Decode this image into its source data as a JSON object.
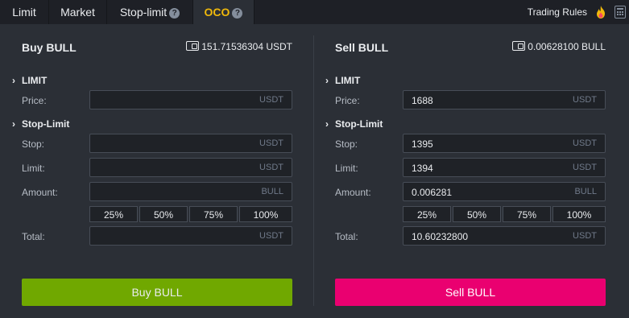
{
  "tabs": [
    {
      "label": "Limit"
    },
    {
      "label": "Market"
    },
    {
      "label": "Stop-limit",
      "help": "?"
    },
    {
      "label": "OCO",
      "help": "?"
    }
  ],
  "trading_rules": "Trading Rules",
  "colors": {
    "accent": "#f0b90b",
    "buy": "#70a800",
    "sell": "#ea0070"
  },
  "buy": {
    "title": "Buy BULL",
    "balance": "151.71536304 USDT",
    "section_limit": "LIMIT",
    "section_stoplimit": "Stop-Limit",
    "price_label": "Price:",
    "price_value": "",
    "price_unit": "USDT",
    "stop_label": "Stop:",
    "stop_value": "",
    "stop_unit": "USDT",
    "limit_label": "Limit:",
    "limit_value": "",
    "limit_unit": "USDT",
    "amount_label": "Amount:",
    "amount_value": "",
    "amount_unit": "BULL",
    "percents": [
      "25%",
      "50%",
      "75%",
      "100%"
    ],
    "total_label": "Total:",
    "total_value": "",
    "total_unit": "USDT",
    "button": "Buy BULL"
  },
  "sell": {
    "title": "Sell BULL",
    "balance": "0.00628100 BULL",
    "section_limit": "LIMIT",
    "section_stoplimit": "Stop-Limit",
    "price_label": "Price:",
    "price_value": "1688",
    "price_unit": "USDT",
    "stop_label": "Stop:",
    "stop_value": "1395",
    "stop_unit": "USDT",
    "limit_label": "Limit:",
    "limit_value": "1394",
    "limit_unit": "USDT",
    "amount_label": "Amount:",
    "amount_value": "0.006281",
    "amount_unit": "BULL",
    "percents": [
      "25%",
      "50%",
      "75%",
      "100%"
    ],
    "total_label": "Total:",
    "total_value": "10.60232800",
    "total_unit": "USDT",
    "button": "Sell BULL"
  }
}
